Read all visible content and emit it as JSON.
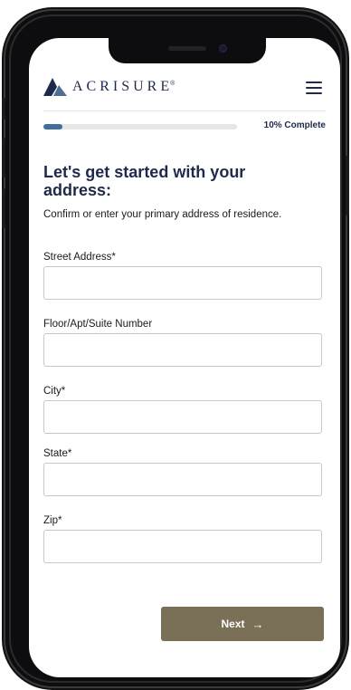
{
  "brand": {
    "name": "ACRISURE",
    "mark": "®",
    "color": "#1f2a4a"
  },
  "header": {
    "menu_icon": "hamburger-menu-icon"
  },
  "progress": {
    "fraction": 0.1,
    "label": "10% Complete",
    "fill_color": "#3f6f9f"
  },
  "form": {
    "title": "Let's get started with your address:",
    "subtitle": "Confirm or enter your primary address of residence.",
    "fields": [
      {
        "label": "Street Address*",
        "value": "",
        "placeholder": ""
      },
      {
        "label": "Floor/Apt/Suite Number",
        "value": "",
        "placeholder": ""
      },
      {
        "label": "City*",
        "value": "",
        "placeholder": ""
      },
      {
        "label": "State*",
        "value": "",
        "placeholder": ""
      },
      {
        "label": "Zip*",
        "value": "",
        "placeholder": ""
      }
    ]
  },
  "actions": {
    "next_label": "Next",
    "next_icon": "arrow-right-icon",
    "next_color": "#7a6f57"
  }
}
